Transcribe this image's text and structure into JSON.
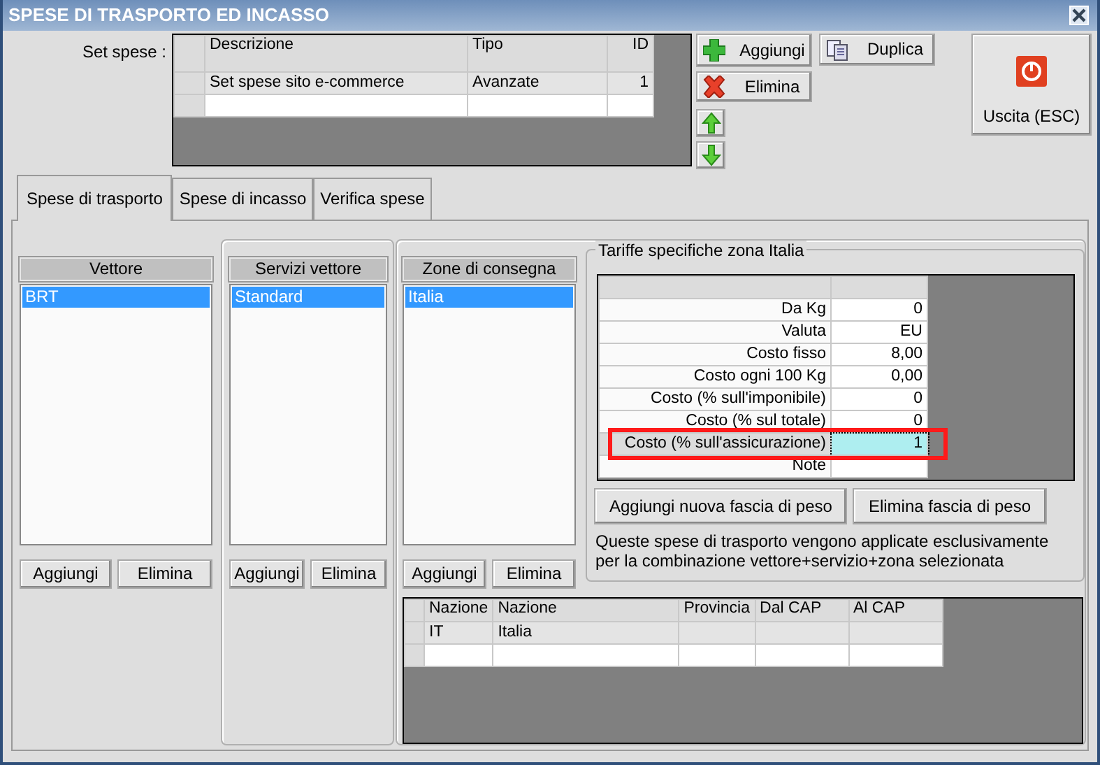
{
  "window": {
    "title": "SPESE DI TRASPORTO ED INCASSO"
  },
  "set_spese": {
    "label": "Set spese :",
    "columns": [
      "Descrizione",
      "Tipo",
      "ID"
    ],
    "rows": [
      {
        "cells": [
          "Set spese sito e-commerce",
          "Avanzate",
          "1"
        ]
      }
    ]
  },
  "toolbar": [
    {
      "label": "Aggiungi",
      "kind": "add"
    },
    {
      "label": "Elimina",
      "kind": "delete"
    },
    {
      "label": "Duplica",
      "kind": "copy"
    }
  ],
  "exit_button": {
    "label": "Uscita (ESC)"
  },
  "tabs": [
    {
      "label": "Spese di trasporto",
      "selected": true
    },
    {
      "label": "Spese di incasso",
      "selected": false
    },
    {
      "label": "Verifica spese",
      "selected": false
    }
  ],
  "lists": [
    {
      "header": "Vettore",
      "items": [
        {
          "label": "BRT",
          "selected": true
        }
      ],
      "buttons": [
        "Aggiungi",
        "Elimina"
      ]
    },
    {
      "header": "Servizi vettore",
      "items": [
        {
          "label": "Standard",
          "selected": true
        }
      ],
      "buttons": [
        "Aggiungi",
        "Elimina"
      ]
    },
    {
      "header": "Zone di consegna",
      "items": [
        {
          "label": "Italia",
          "selected": true
        }
      ],
      "buttons": [
        "Aggiungi",
        "Elimina"
      ]
    }
  ],
  "tariffe": {
    "title": "Tariffe specifiche zona Italia",
    "rows": [
      {
        "label": "Da Kg",
        "value": "0",
        "selected": false,
        "highlighted": false
      },
      {
        "label": "Valuta",
        "value": "EU",
        "selected": false,
        "highlighted": false
      },
      {
        "label": "Costo fisso",
        "value": "8,00",
        "selected": false,
        "highlighted": false
      },
      {
        "label": "Costo ogni 100 Kg",
        "value": "0,00",
        "selected": false,
        "highlighted": false
      },
      {
        "label": "Costo (% sull'imponibile)",
        "value": "0",
        "selected": false,
        "highlighted": false
      },
      {
        "label": "Costo (% sul totale)",
        "value": "0",
        "selected": false,
        "highlighted": false
      },
      {
        "label": "Costo (% sull'assicurazione)",
        "value": "1",
        "selected": true,
        "highlighted": true
      },
      {
        "label": "Note",
        "selected": false,
        "highlighted": false
      }
    ],
    "buttons": [
      "Aggiungi nuova fascia di peso",
      "Elimina fascia di peso"
    ],
    "note": "Queste spese di trasporto vengono applicate esclusivamente per la combinazione vettore+servizio+zona selezionata"
  },
  "zone_table": {
    "columns": [
      "Nazione",
      "Nazione",
      "Provincia",
      "Dal CAP",
      "Al CAP"
    ],
    "rows": [
      {
        "cells": [
          "IT",
          "Italia"
        ]
      }
    ]
  }
}
